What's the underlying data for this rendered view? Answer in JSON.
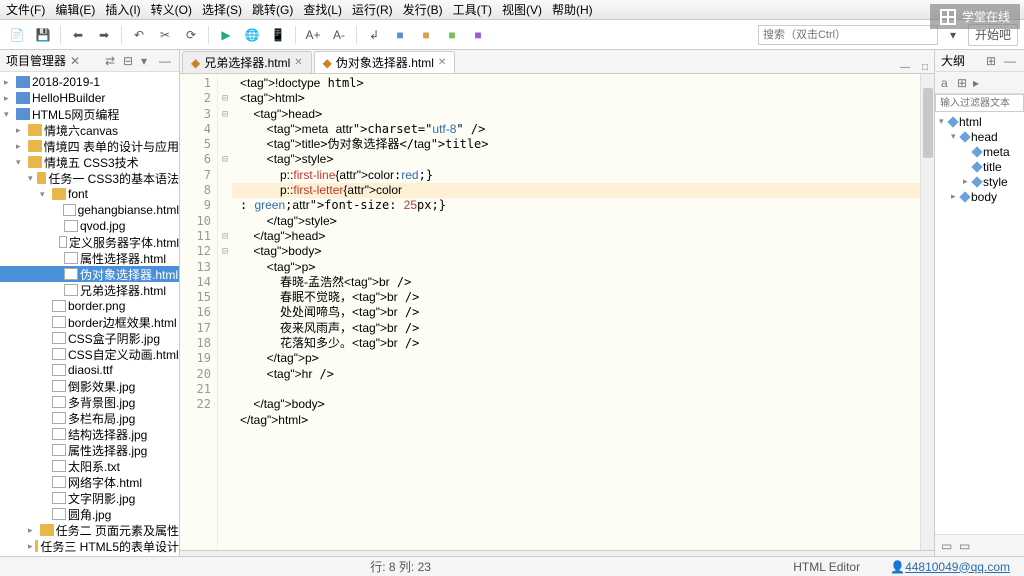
{
  "menu": [
    "文件(F)",
    "编辑(E)",
    "插入(I)",
    "转义(O)",
    "选择(S)",
    "跳转(G)",
    "查找(L)",
    "运行(R)",
    "发行(B)",
    "工具(T)",
    "视图(V)",
    "帮助(H)"
  ],
  "logo_text": "学堂在线",
  "search_placeholder": "搜索（双击Ctrl）",
  "btn_label": "开始吧",
  "panes": {
    "project": {
      "title": "项目管理器",
      "close_glyph": "✕"
    },
    "outline_tab": "大纲",
    "outline_filter": "输入过滤器文本"
  },
  "tree": [
    {
      "depth": 0,
      "arrow": "▸",
      "icon": "wicon",
      "label": "2018-2019-1"
    },
    {
      "depth": 0,
      "arrow": "▸",
      "icon": "wicon",
      "label": "HelloHBuilder"
    },
    {
      "depth": 0,
      "arrow": "▾",
      "icon": "wicon",
      "label": "HTML5网页编程"
    },
    {
      "depth": 1,
      "arrow": "▸",
      "icon": "folder",
      "label": "情境六canvas"
    },
    {
      "depth": 1,
      "arrow": "▸",
      "icon": "folder",
      "label": "情境四 表单的设计与应用"
    },
    {
      "depth": 1,
      "arrow": "▾",
      "icon": "folder-open",
      "label": "情境五 CSS3技术"
    },
    {
      "depth": 2,
      "arrow": "▾",
      "icon": "folder-open",
      "label": "任务一 CSS3的基本语法"
    },
    {
      "depth": 3,
      "arrow": "▾",
      "icon": "folder-open",
      "label": "font"
    },
    {
      "depth": 4,
      "arrow": "",
      "icon": "file",
      "label": "gehangbianse.html"
    },
    {
      "depth": 4,
      "arrow": "",
      "icon": "file",
      "label": "qvod.jpg"
    },
    {
      "depth": 4,
      "arrow": "",
      "icon": "file",
      "label": "定义服务器字体.html"
    },
    {
      "depth": 4,
      "arrow": "",
      "icon": "file",
      "label": "属性选择器.html"
    },
    {
      "depth": 4,
      "arrow": "",
      "icon": "file",
      "label": "伪对象选择器.html",
      "selected": true
    },
    {
      "depth": 4,
      "arrow": "",
      "icon": "file",
      "label": "兄弟选择器.html"
    },
    {
      "depth": 3,
      "arrow": "",
      "icon": "file",
      "label": "border.png"
    },
    {
      "depth": 3,
      "arrow": "",
      "icon": "file",
      "label": "border边框效果.html"
    },
    {
      "depth": 3,
      "arrow": "",
      "icon": "file",
      "label": "CSS盒子阴影.jpg"
    },
    {
      "depth": 3,
      "arrow": "",
      "icon": "file",
      "label": "CSS自定义动画.html"
    },
    {
      "depth": 3,
      "arrow": "",
      "icon": "file",
      "label": "diaosi.ttf"
    },
    {
      "depth": 3,
      "arrow": "",
      "icon": "file",
      "label": "倒影效果.jpg"
    },
    {
      "depth": 3,
      "arrow": "",
      "icon": "file",
      "label": "多背景图.jpg"
    },
    {
      "depth": 3,
      "arrow": "",
      "icon": "file",
      "label": "多栏布局.jpg"
    },
    {
      "depth": 3,
      "arrow": "",
      "icon": "file",
      "label": "结构选择器.jpg"
    },
    {
      "depth": 3,
      "arrow": "",
      "icon": "file",
      "label": "属性选择器.jpg"
    },
    {
      "depth": 3,
      "arrow": "",
      "icon": "file",
      "label": "太阳系.txt"
    },
    {
      "depth": 3,
      "arrow": "",
      "icon": "file",
      "label": "网络字体.html"
    },
    {
      "depth": 3,
      "arrow": "",
      "icon": "file",
      "label": "文字阴影.jpg"
    },
    {
      "depth": 3,
      "arrow": "",
      "icon": "file",
      "label": "圆角.jpg"
    },
    {
      "depth": 2,
      "arrow": "▸",
      "icon": "folder",
      "label": "任务二 页面元素及属性"
    },
    {
      "depth": 2,
      "arrow": "▸",
      "icon": "folder",
      "label": "任务三 HTML5的表单设计"
    }
  ],
  "tabs": [
    {
      "label": "兄弟选择器.html",
      "active": false
    },
    {
      "label": "伪对象选择器.html",
      "active": true
    }
  ],
  "code": {
    "lines": [
      "<!doctype html>",
      "<html>",
      "    <head>",
      "        <meta charset=\"utf-8\" />",
      "        <title>伪对象选择器</title>",
      "        <style>",
      "            p::first-line{color:red;}",
      "            p::first-letter{color: green;font-size: 25px;}",
      "        </style>",
      "    </head>",
      "    <body>",
      "        <p>",
      "            春晓-孟浩然<br />",
      "            春眠不觉晓，<br />",
      "            处处闻啼鸟，<br />",
      "            夜来风雨声，<br />",
      "            花落知多少。<br />",
      "        </p>",
      "        <hr />",
      "",
      "    </body>",
      "</html>"
    ],
    "highlight_line": 8
  },
  "outline": [
    {
      "depth": 0,
      "arrow": "▾",
      "label": "html"
    },
    {
      "depth": 1,
      "arrow": "▾",
      "label": "head"
    },
    {
      "depth": 2,
      "arrow": "",
      "label": "meta"
    },
    {
      "depth": 2,
      "arrow": "",
      "label": "title"
    },
    {
      "depth": 2,
      "arrow": "▸",
      "label": "style"
    },
    {
      "depth": 1,
      "arrow": "▸",
      "label": "body"
    }
  ],
  "status": {
    "pos": "行: 8 列: 23",
    "mode": "HTML Editor",
    "user": "44810049@qq.com"
  }
}
